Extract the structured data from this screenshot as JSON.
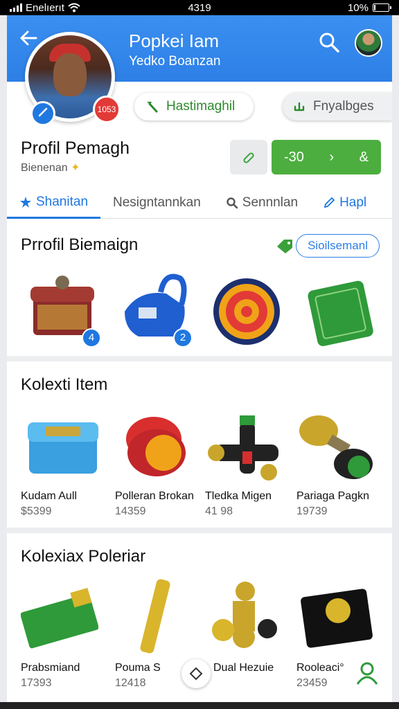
{
  "status_bar": {
    "carrier": "Enelıerıt",
    "time": "4319",
    "battery_text": "10%",
    "battery_level": 0.1
  },
  "header": {
    "back_icon": "arrow-left-icon",
    "title": "Popkei Iam",
    "subtitle": "Yedko Boanzan",
    "search_icon": "search-icon"
  },
  "profile": {
    "badge_count": "1053",
    "follow_button": "Hastimaghil",
    "secondary_button": "Fnyalbges",
    "name": "Profil Pemagh",
    "subtitle": "Bienenan",
    "action_value": "-30",
    "action_symbol": "&"
  },
  "tabs": [
    {
      "label": "Shanitan",
      "icon": "star-icon"
    },
    {
      "label": "Nesigntannkan",
      "icon": ""
    },
    {
      "label": "Sennnlan",
      "icon": "search-icon"
    },
    {
      "label": "Hapl",
      "icon": "pencil-icon"
    }
  ],
  "sections": [
    {
      "title": "Prrofil Biemaign",
      "action_label": "Sioilsemanl",
      "items": [
        {
          "name": "treasure-chest",
          "badge": "4",
          "color": "#8b2c2a"
        },
        {
          "name": "blue-backpack",
          "badge": "2",
          "color": "#1f5fd0"
        },
        {
          "name": "target-medal",
          "badge": "",
          "color": "#f0a318"
        },
        {
          "name": "green-card",
          "badge": "",
          "color": "#2f9a3a"
        }
      ]
    },
    {
      "title": "Kolexti Item",
      "items": [
        {
          "label": "Kudam Aull",
          "value": "$5399",
          "color": "#3aa0e0"
        },
        {
          "label": "Polleran Brokan",
          "value": "14359",
          "color": "#d82e2e"
        },
        {
          "label": "Tledka Migen",
          "value": "41 98",
          "color": "#222222"
        },
        {
          "label": "Pariaga Pagkn",
          "value": "19739",
          "color": "#c9a52b"
        }
      ]
    },
    {
      "title": "Kolexiax Poleriar",
      "items": [
        {
          "label": "Prabsmiand",
          "value": "17393",
          "color": "#2f9a3a"
        },
        {
          "label": "Pouma S",
          "value": "12418",
          "color": "#d9b52c"
        },
        {
          "label": "Dual Hezuie",
          "value": "",
          "color": "#c9a52b"
        },
        {
          "label": "Rooleaci°",
          "value": "23459",
          "color": "#111111"
        }
      ]
    }
  ],
  "colors": {
    "primary": "#2d7fe6",
    "accent_green": "#4cae3e",
    "badge_red": "#e23a36"
  }
}
